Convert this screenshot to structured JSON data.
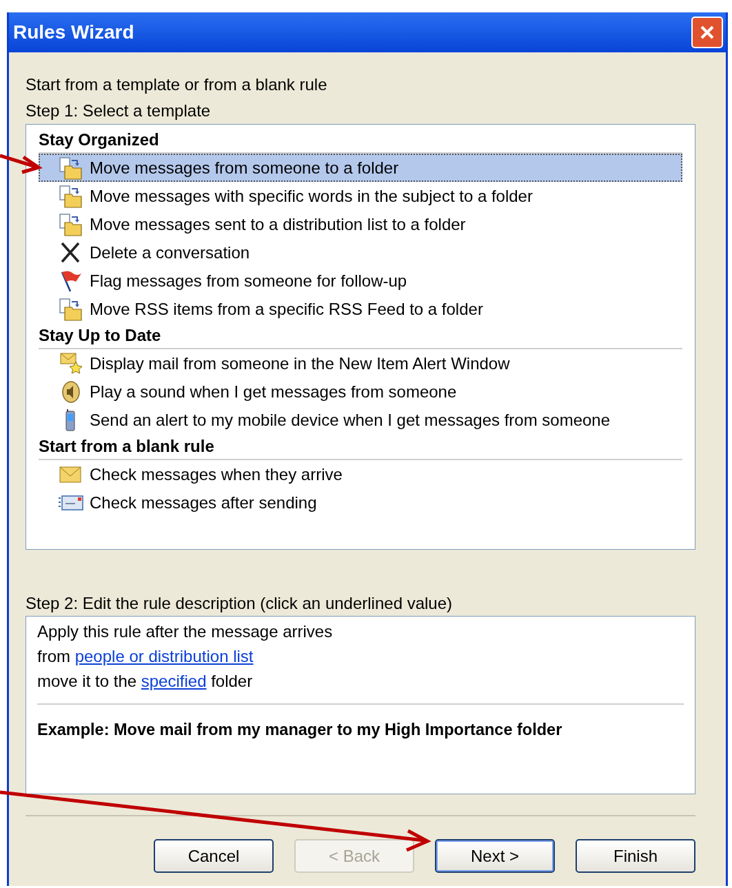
{
  "window": {
    "title": "Rules Wizard"
  },
  "intro": "Start from a template or from a blank rule",
  "step1": "Step 1: Select a template",
  "groups": [
    {
      "heading": "Stay Organized",
      "items": [
        {
          "label": "Move messages from someone to a folder",
          "kind": "move",
          "selected": true
        },
        {
          "label": "Move messages with specific words in the subject to a folder",
          "kind": "move",
          "selected": false
        },
        {
          "label": "Move messages sent to a distribution list to a folder",
          "kind": "move",
          "selected": false
        },
        {
          "label": "Delete a conversation",
          "kind": "delete",
          "selected": false
        },
        {
          "label": "Flag messages from someone for follow-up",
          "kind": "flag",
          "selected": false
        },
        {
          "label": "Move RSS items from a specific RSS Feed to a folder",
          "kind": "move",
          "selected": false
        }
      ]
    },
    {
      "heading": "Stay Up to Date",
      "items": [
        {
          "label": "Display mail from someone in the New Item Alert Window",
          "kind": "alert",
          "selected": false
        },
        {
          "label": "Play a sound when I get messages from someone",
          "kind": "sound",
          "selected": false
        },
        {
          "label": "Send an alert to my mobile device when I get messages from someone",
          "kind": "mobile",
          "selected": false
        }
      ]
    },
    {
      "heading": "Start from a blank rule",
      "items": [
        {
          "label": "Check messages when they arrive",
          "kind": "envelope",
          "selected": false
        },
        {
          "label": "Check messages after sending",
          "kind": "send",
          "selected": false
        }
      ]
    }
  ],
  "step2": "Step 2: Edit the rule description (click an underlined value)",
  "description": [
    [
      {
        "kind": "text",
        "text": "Apply this rule after the message arrives"
      }
    ],
    [
      {
        "kind": "text",
        "text": "from "
      },
      {
        "kind": "link",
        "text": "people or distribution list"
      }
    ],
    [
      {
        "kind": "text",
        "text": "move it to the "
      },
      {
        "kind": "link",
        "text": "specified"
      },
      {
        "kind": "text",
        "text": " folder"
      }
    ]
  ],
  "example": "Example: Move mail from my manager to my High Importance folder",
  "buttons": [
    {
      "label": "Cancel",
      "disabled": false,
      "default": false
    },
    {
      "label": "< Back",
      "disabled": true,
      "default": false
    },
    {
      "label": "Next >",
      "disabled": false,
      "default": true
    },
    {
      "label": "Finish",
      "disabled": false,
      "default": false
    }
  ]
}
